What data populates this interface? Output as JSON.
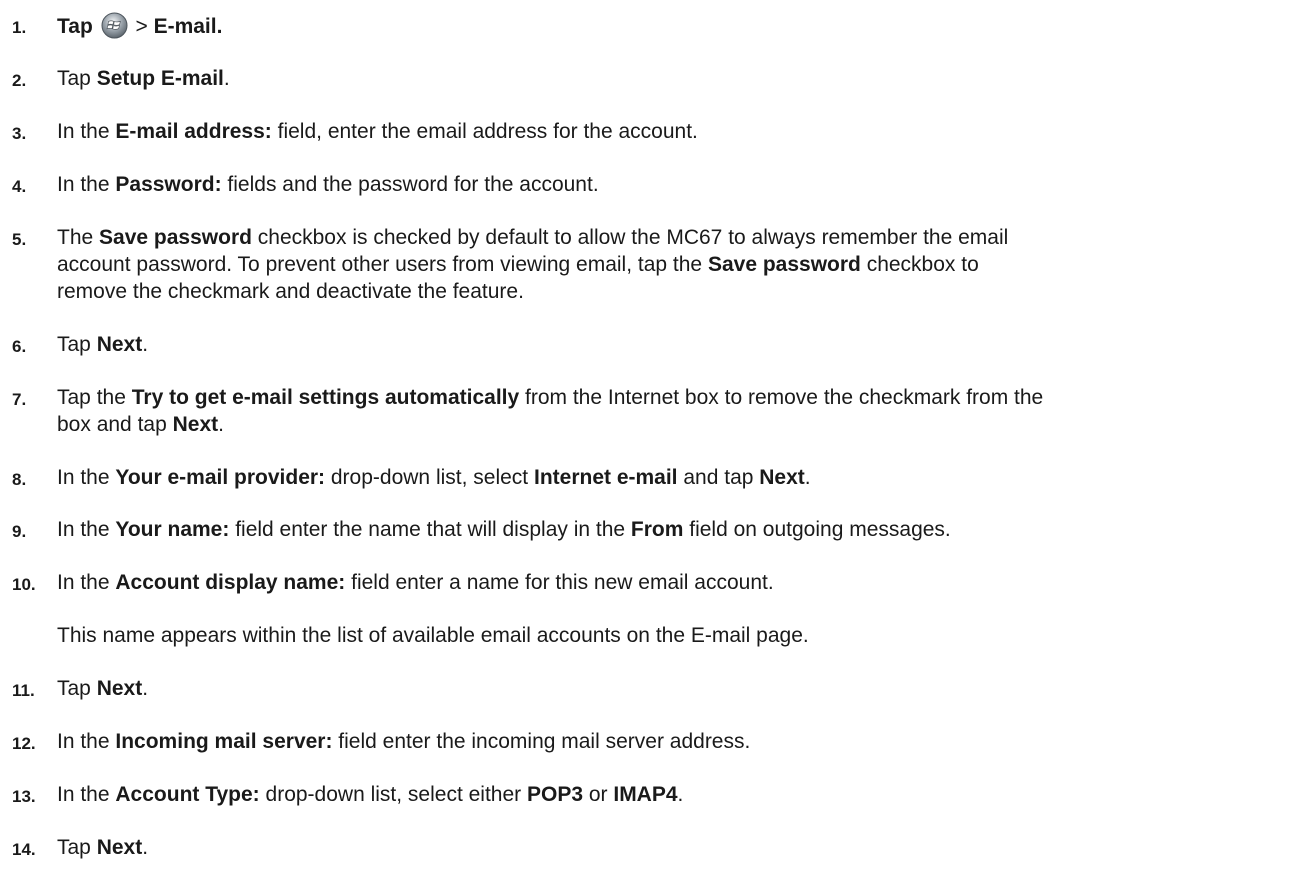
{
  "steps": [
    {
      "number": "1.",
      "parts": [
        {
          "t": "Tap ",
          "b": true
        },
        {
          "icon": "windows-start-icon"
        },
        {
          "t": " > ",
          "b": false
        },
        {
          "t": "E-mail.",
          "b": true
        }
      ]
    },
    {
      "number": "2.",
      "parts": [
        {
          "t": "Tap ",
          "b": false
        },
        {
          "t": "Setup E-mail",
          "b": true
        },
        {
          "t": ".",
          "b": false
        }
      ]
    },
    {
      "number": "3.",
      "parts": [
        {
          "t": "In the ",
          "b": false
        },
        {
          "t": "E-mail address:",
          "b": true
        },
        {
          "t": " field, enter the email address for the account.",
          "b": false
        }
      ]
    },
    {
      "number": "4.",
      "parts": [
        {
          "t": "In the ",
          "b": false
        },
        {
          "t": "Password:",
          "b": true
        },
        {
          "t": " fields and the password for the account.",
          "b": false
        }
      ]
    },
    {
      "number": "5.",
      "lines": [
        [
          {
            "t": "The ",
            "b": false
          },
          {
            "t": "Save password",
            "b": true
          },
          {
            "t": " checkbox is checked by default to allow the MC67 to always remember the email",
            "b": false
          }
        ],
        [
          {
            "t": "account password. To prevent other users from viewing email, tap the ",
            "b": false
          },
          {
            "t": "Save password",
            "b": true
          },
          {
            "t": " checkbox to",
            "b": false
          }
        ],
        [
          {
            "t": "remove the checkmark and deactivate the feature.",
            "b": false
          }
        ]
      ]
    },
    {
      "number": "6.",
      "parts": [
        {
          "t": "Tap ",
          "b": false
        },
        {
          "t": "Next",
          "b": true
        },
        {
          "t": ".",
          "b": false
        }
      ]
    },
    {
      "number": "7.",
      "lines": [
        [
          {
            "t": "Tap the ",
            "b": false
          },
          {
            "t": "Try to get e-mail settings automatically",
            "b": true
          },
          {
            "t": " from the Internet box to remove the checkmark from the",
            "b": false
          }
        ],
        [
          {
            "t": "box and tap ",
            "b": false
          },
          {
            "t": "Next",
            "b": true
          },
          {
            "t": ".",
            "b": false
          }
        ]
      ]
    },
    {
      "number": "8.",
      "parts": [
        {
          "t": "In the ",
          "b": false
        },
        {
          "t": "Your e-mail provider:",
          "b": true
        },
        {
          "t": " drop-down list, select ",
          "b": false
        },
        {
          "t": "Internet e-mail",
          "b": true
        },
        {
          "t": " and tap ",
          "b": false
        },
        {
          "t": "Next",
          "b": true
        },
        {
          "t": ".",
          "b": false
        }
      ]
    },
    {
      "number": "9.",
      "parts": [
        {
          "t": "In the ",
          "b": false
        },
        {
          "t": "Your name:",
          "b": true
        },
        {
          "t": " field enter the name that will display in the ",
          "b": false
        },
        {
          "t": "From",
          "b": true
        },
        {
          "t": " field on outgoing messages.",
          "b": false
        }
      ]
    },
    {
      "number": "10.",
      "parts": [
        {
          "t": "In the ",
          "b": false
        },
        {
          "t": "Account display name:",
          "b": true
        },
        {
          "t": " field enter a name for this new email account.",
          "b": false
        }
      ],
      "note": "This name appears within the list of available email accounts on the E-mail page."
    },
    {
      "number": "11.",
      "parts": [
        {
          "t": "Tap ",
          "b": false
        },
        {
          "t": "Next",
          "b": true
        },
        {
          "t": ".",
          "b": false
        }
      ]
    },
    {
      "number": "12.",
      "parts": [
        {
          "t": "In the ",
          "b": false
        },
        {
          "t": "Incoming mail server:",
          "b": true
        },
        {
          "t": " field enter the incoming mail server address.",
          "b": false
        }
      ]
    },
    {
      "number": "13.",
      "parts": [
        {
          "t": "In the ",
          "b": false
        },
        {
          "t": "Account Type:",
          "b": true
        },
        {
          "t": " drop-down list, select either ",
          "b": false
        },
        {
          "t": "POP3",
          "b": true
        },
        {
          "t": " or ",
          "b": false
        },
        {
          "t": "IMAP4",
          "b": true
        },
        {
          "t": ".",
          "b": false
        }
      ]
    },
    {
      "number": "14.",
      "parts": [
        {
          "t": "Tap ",
          "b": false
        },
        {
          "t": "Next",
          "b": true
        },
        {
          "t": ".",
          "b": false
        }
      ]
    }
  ]
}
